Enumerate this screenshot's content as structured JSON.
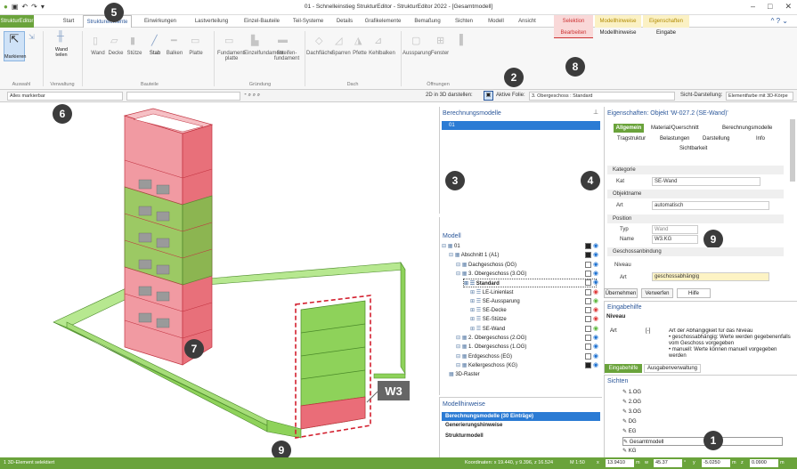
{
  "titlebar": {
    "title": "01 - Schnelleinstieg StrukturEditor - StrukturEditor 2022 - [Gesamtmodell]"
  },
  "tabs": [
    {
      "label": "StrukturEditor"
    },
    {
      "label": "Start"
    },
    {
      "label": "Strukturelemente"
    },
    {
      "label": "Einwirkungen"
    },
    {
      "label": "Lastverteilung"
    },
    {
      "label": "Einzel-Bauteile"
    },
    {
      "label": "Teil-Systeme"
    },
    {
      "label": "Details"
    },
    {
      "label": "Grafikelemente"
    },
    {
      "label": "Bemaßung"
    },
    {
      "label": "Sichten"
    },
    {
      "label": "Modell"
    },
    {
      "label": "Ansicht"
    }
  ],
  "context_tabs": {
    "selektion": "Selektion",
    "bearbeiten": "Bearbeiten",
    "modellhinweise_top": "Modellhinweise",
    "modellhinweise": "Modellhinweise",
    "eigenschaften": "Eigenschaften",
    "eingabe": "Eingabe"
  },
  "ribbon": {
    "markieren": "Markieren",
    "wand_teilen": "Wand\nteilen",
    "auswahl": "Auswahl",
    "verwaltung": "Verwaltung",
    "bauteile_items": [
      "Wand",
      "Decke",
      "Stütze",
      "Stab",
      "Balken",
      "Platte"
    ],
    "bauteile": "Bauteile",
    "gruendung_items": [
      "Fundament-\nplatte",
      "Einzelfundament",
      "Streifen-\nfundament"
    ],
    "gruendung": "Gründung",
    "dach_items": [
      "Dachfläche",
      "Sparren",
      "Pfette",
      "Kehlbalken"
    ],
    "dach": "Dach",
    "oeffnungen_items": [
      "Aussparung",
      "Fenster"
    ],
    "oeffnungen": "Öffnungen"
  },
  "toolbar": {
    "filter": "Alles markierbar",
    "darstellen": "2D in 3D darstellen:",
    "aktive_folie_label": "Aktive Folie:",
    "aktive_folie": "3. Obergeschoss : Standard",
    "sicht_label": "Sicht-Darstellung:",
    "sicht": "Elementfarbe mit 3D-Körpe"
  },
  "berechnungsmodelle": {
    "title": "Berechnungsmodelle",
    "item": "01"
  },
  "modell": {
    "title": "Modell",
    "rows": [
      {
        "label": "01",
        "eye": "blue",
        "chk": "on"
      },
      {
        "label": "Abschnitt 1 (A1)",
        "eye": "blue",
        "chk": "on"
      },
      {
        "label": "Dachgeschoss (DG)",
        "eye": "blue",
        "chk": "off"
      },
      {
        "label": "3. Obergeschoss (3.OG)",
        "eye": "blue",
        "chk": "off"
      },
      {
        "label": "Standard",
        "eye": "blue",
        "chk": "off"
      },
      {
        "label": "LE-Linienlast",
        "eye": "red",
        "chk": "off"
      },
      {
        "label": "SE-Aussparung",
        "eye": "green",
        "chk": "off"
      },
      {
        "label": "SE-Decke",
        "eye": "red",
        "chk": "off"
      },
      {
        "label": "SE-Stütze",
        "eye": "red",
        "chk": "off"
      },
      {
        "label": "SE-Wand",
        "eye": "green",
        "chk": "off"
      },
      {
        "label": "2. Obergeschoss (2.OG)",
        "eye": "blue",
        "chk": "off"
      },
      {
        "label": "1. Obergeschoss (1.OG)",
        "eye": "blue",
        "chk": "off"
      },
      {
        "label": "Erdgeschoss (EG)",
        "eye": "blue",
        "chk": "off"
      },
      {
        "label": "Kellergeschoss (KG)",
        "eye": "blue",
        "chk": "on"
      },
      {
        "label": "3D-Raster",
        "eye": "",
        "chk": ""
      }
    ]
  },
  "modellhinweise": {
    "title": "Modellhinweise",
    "rows": [
      "Berechnungsmodelle (30 Einträge)",
      "Generierungshinweise",
      "Strukturmodell"
    ]
  },
  "eigenschaften": {
    "title": "Eigenschaften: Objekt 'W-027.2 (SE-Wand)'",
    "tabs": [
      "Allgemein",
      "Material/Querschnitt",
      "Berechnungsmodelle",
      "Tragstruktur",
      "Belastungen",
      "Darstellung",
      "Info",
      "Sichtbarkeit"
    ],
    "sections": {
      "kategorie": "Kategorie",
      "kat_label": "Kat",
      "kat_value": "SE-Wand",
      "objektname": "Objektname",
      "art_label": "Art",
      "art_value": "automatisch",
      "position": "Position",
      "typ_label": "Typ",
      "typ_value": "Wand",
      "name_label": "Name",
      "name_value": "W3.KG",
      "geschoss": "Geschossanbindung",
      "niveau": "Niveau",
      "art2_label": "Art",
      "art2_value": "geschossabhängig"
    },
    "buttons": {
      "uebernehmen": "Übernehmen",
      "verwerfen": "Verwerfen",
      "hilfe": "Hilfe"
    }
  },
  "eingabehilfe": {
    "title": "Eingabehilfe",
    "heading": "Niveau",
    "art": "Art",
    "unit": "[-]",
    "text": "Art der Abhängigkeit für das Niveau\n• geschossabhängig: Werte werden gegebenenfalls vom Geschoss vorgegeben\n• manuell: Werte können manuell vorgegeben werden",
    "tabs": [
      "Eingabehilfe",
      "Ausgabenverwaltung"
    ]
  },
  "sichten": {
    "title": "Sichten",
    "rows": [
      "1.OG",
      "2.OG",
      "3.OG",
      "DG",
      "EG",
      "Gesamtmodell",
      "KG"
    ]
  },
  "view": {
    "label_w3": "W3"
  },
  "markers": [
    "1",
    "2",
    "3",
    "4",
    "5",
    "6",
    "7",
    "8",
    "9",
    "9"
  ],
  "status": {
    "left": "1 3D-Element selektiert",
    "coords": "Koordinaten: x 19.440, y 9.396, z 16.524",
    "scale": "M 1:50",
    "fields": [
      "x",
      "13.9410",
      "m",
      "w",
      "45.37",
      "°",
      "y",
      "-5.0250",
      "m",
      "z",
      "0.0900",
      "m"
    ]
  },
  "colors": {
    "green": "#6aa33b",
    "blue": "#2b579a",
    "wallGreen": "#8ed25a",
    "wallRed": "#e8707a"
  }
}
